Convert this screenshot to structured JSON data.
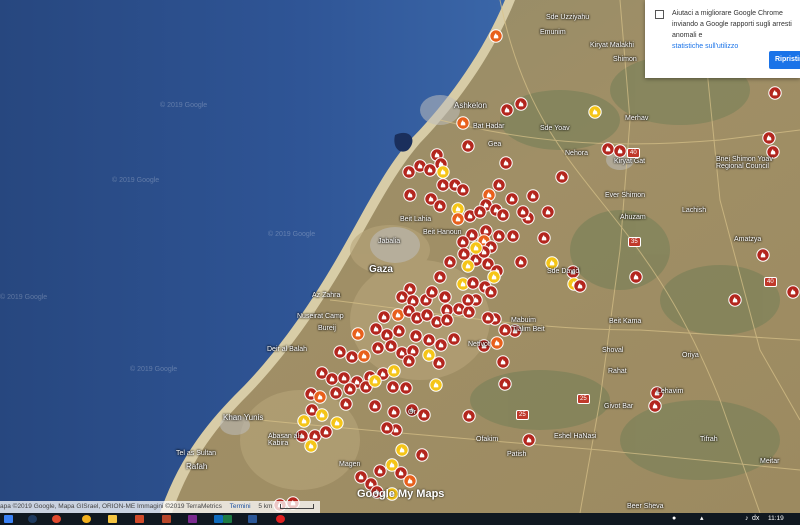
{
  "map": {
    "towns": [
      {
        "name": "Sde Uzziyahu",
        "size": "sm"
      },
      {
        "name": "Emunim",
        "size": "sm"
      },
      {
        "name": "Kiryat Malakhi",
        "size": "sm"
      },
      {
        "name": "Shimon",
        "size": "sm"
      },
      {
        "name": "Ashkelon",
        "size": "md"
      },
      {
        "name": "Bat Hadar",
        "size": "sm"
      },
      {
        "name": "Sde Yoav",
        "size": "sm"
      },
      {
        "name": "Merhav",
        "size": "sm"
      },
      {
        "name": "Gea",
        "size": "sm"
      },
      {
        "name": "Nehora",
        "size": "sm"
      },
      {
        "name": "Kiryat Gat",
        "size": "sm"
      },
      {
        "name": "Bnei Shimon Yoav Regional Council",
        "size": "sm"
      },
      {
        "name": "Ever Shimon",
        "size": "sm"
      },
      {
        "name": "Lachish",
        "size": "sm"
      },
      {
        "name": "Ahuzam",
        "size": "sm"
      },
      {
        "name": "Amatzya",
        "size": "sm"
      },
      {
        "name": "Beit Lahia",
        "size": "sm"
      },
      {
        "name": "Beit Hanoun",
        "size": "sm"
      },
      {
        "name": "Jabalia",
        "size": "sm"
      },
      {
        "name": "Gaza",
        "size": "lg"
      },
      {
        "name": "Sde David",
        "size": "sm"
      },
      {
        "name": "Az Zahra",
        "size": "sm"
      },
      {
        "name": "Nuseirat Camp",
        "size": "sm"
      },
      {
        "name": "Bureij",
        "size": "sm"
      },
      {
        "name": "Deir al Balah",
        "size": "sm"
      },
      {
        "name": "Beit Kama",
        "size": "sm"
      },
      {
        "name": "Shoval",
        "size": "sm"
      },
      {
        "name": "Rahat",
        "size": "sm"
      },
      {
        "name": "Lehavim",
        "size": "sm"
      },
      {
        "name": "Givot Bar",
        "size": "sm"
      },
      {
        "name": "Khan Yunis",
        "size": "md"
      },
      {
        "name": "Abasan al-Kabira",
        "size": "sm"
      },
      {
        "name": "Rafah",
        "size": "md"
      },
      {
        "name": "Tel as Sultan",
        "size": "sm"
      },
      {
        "name": "Magen",
        "size": "sm"
      },
      {
        "name": "Eshel HaNasi",
        "size": "sm"
      },
      {
        "name": "Ofakim",
        "size": "sm"
      },
      {
        "name": "Tifrah",
        "size": "sm"
      },
      {
        "name": "Meitar",
        "size": "sm"
      },
      {
        "name": "Beer Sheva",
        "size": "sm"
      },
      {
        "name": "Mabuim",
        "size": "sm"
      },
      {
        "name": "Tlalim Beit",
        "size": "sm"
      },
      {
        "name": "Oriya",
        "size": "sm"
      },
      {
        "name": "Patish",
        "size": "sm"
      },
      {
        "name": "Netivot",
        "size": "sm"
      },
      {
        "name": "Or",
        "size": "sm"
      }
    ],
    "watermark": "© 2019 Google",
    "route_shields": [
      "40",
      "35",
      "25",
      "25",
      "40"
    ],
    "markers_note": ""
  },
  "popup": {
    "message": "Aiutaci a migliorare Google Chrome inviando a Google rapporti sugli arresti anomali e",
    "link": "statistiche sull'utilizzo",
    "button": "Ripristina"
  },
  "attribution": {
    "data": "apa ©2019 Google, Mapa GISrael, ORION-ME Immagini ©2019 TerraMetrics",
    "terms": "Termini",
    "scale": "5 km"
  },
  "branding": {
    "google": "Google",
    "mymaps": "My Maps"
  },
  "taskbar": {
    "time": "11:19",
    "lang": "dx"
  },
  "colors": {
    "sea": "#2a4d8f",
    "land": "#9a8a62",
    "marker_red": "#b3261e",
    "marker_orange": "#e8601c",
    "marker_yellow": "#f5c518"
  }
}
